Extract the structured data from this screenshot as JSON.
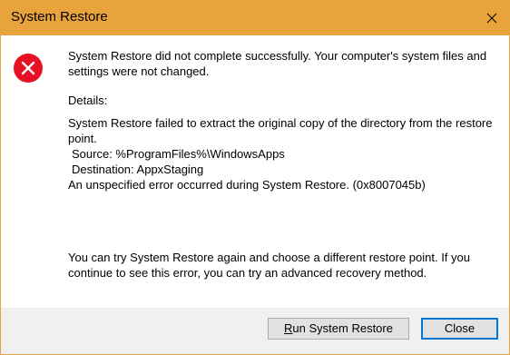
{
  "window": {
    "title": "System Restore"
  },
  "icons": {
    "error": "error-icon",
    "close": "close-icon"
  },
  "colors": {
    "title_bar": "#e8a33c",
    "error_icon": "#e81123",
    "footer_bar": "#f0f0f0",
    "button": "#e1e1e1",
    "button_focus_border": "#0078d7"
  },
  "message": {
    "line1": "System Restore did not complete successfully. Your computer's system files and",
    "line2": "settings were not changed."
  },
  "details": {
    "label": "Details:",
    "line1": "System Restore failed to extract the original copy of the directory from the restore",
    "line2": "point.",
    "source": "Source: %ProgramFiles%\\WindowsApps",
    "destination": "Destination: AppxStaging",
    "error": "An unspecified error occurred during System Restore. (0x8007045b)"
  },
  "footer_message": {
    "line1": "You can try System Restore again and choose a different restore point. If you",
    "line2": "continue to see this error, you can try an advanced recovery method."
  },
  "buttons": {
    "run_restore": {
      "access_key": "R",
      "rest": "un System Restore"
    },
    "close": "Close"
  }
}
